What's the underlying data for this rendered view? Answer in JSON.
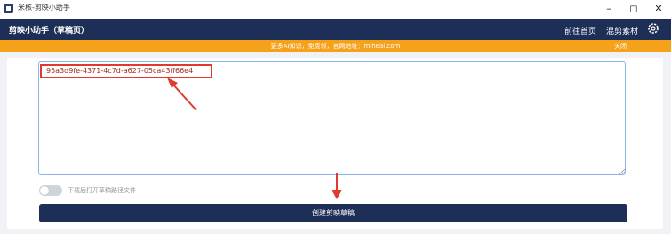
{
  "window": {
    "title": "米核-剪映小助手",
    "icon": "app-logo-icon",
    "controls": [
      "minimize-icon",
      "maximize-icon",
      "close-icon"
    ]
  },
  "header": {
    "title": "剪映小助手（草稿页）",
    "nav_home": "前往首页",
    "nav_materials": "混剪素材",
    "settings_icon": "gear-icon"
  },
  "notice": {
    "text": "更多AI知识，免费领，官网地址：miheai.com",
    "close_label": "关闭"
  },
  "editor": {
    "value": "95a3d9fe-4371-4c7d-a627-05ca43ff66e4",
    "highlight_color": "#e03a2f"
  },
  "toggle": {
    "label": "下载后打开草稿路径文件",
    "checked": false
  },
  "action": {
    "create_label": "创建剪映草稿"
  },
  "colors": {
    "header_bg": "#1e2f57",
    "notice_bg": "#f5a11a",
    "annotation": "#e03a2f"
  }
}
